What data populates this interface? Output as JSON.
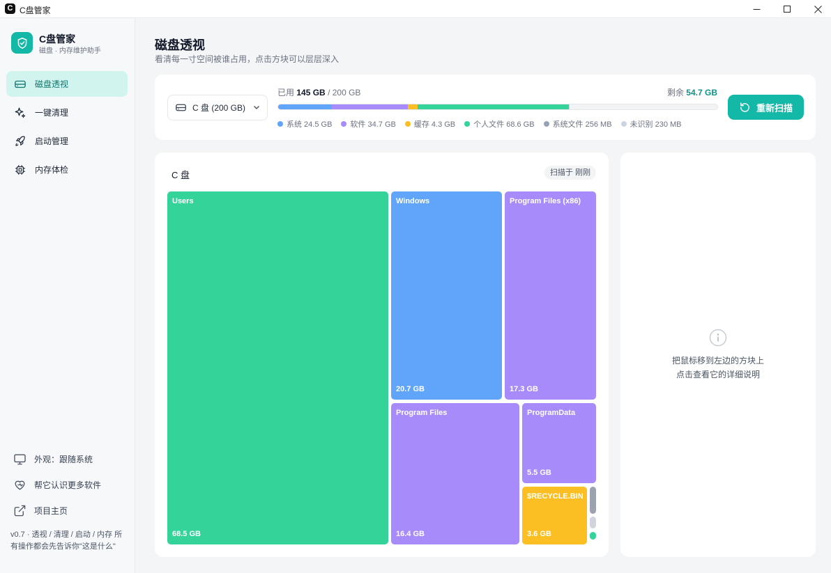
{
  "window": {
    "icon_letter": "C",
    "title": "C盘管家"
  },
  "brand": {
    "name": "C盘管家",
    "subtitle": "磁盘 · 内存维护助手"
  },
  "nav": [
    {
      "label": "磁盘透视",
      "icon": "disk-icon",
      "active": true
    },
    {
      "label": "一键清理",
      "icon": "sparkle-icon",
      "active": false
    },
    {
      "label": "启动管理",
      "icon": "rocket-icon",
      "active": false
    },
    {
      "label": "内存体检",
      "icon": "chip-icon",
      "active": false
    }
  ],
  "footer": {
    "appearance": "外观：跟随系统",
    "help": "帮它认识更多软件",
    "homepage": "项目主页",
    "version": "v0.7 · 透视 / 清理 / 启动 / 内存 所有操作都会先告诉你\"这是什么\""
  },
  "page": {
    "title": "磁盘透视",
    "subtitle": "看清每一寸空间被谁占用，点击方块可以层层深入"
  },
  "drive": {
    "selected": "C 盘 (200 GB)",
    "used_label": "已用",
    "used": "145 GB",
    "total": "/ 200 GB",
    "remain_label": "剩余",
    "remain": "54.7 GB",
    "rescan_label": "重新扫描",
    "segments": [
      {
        "name": "系统",
        "value_gb": 24.5,
        "color": "#60a5fa"
      },
      {
        "name": "软件",
        "value_gb": 34.7,
        "color": "#a78bfa"
      },
      {
        "name": "缓存",
        "value_gb": 4.3,
        "color": "#fbbf24"
      },
      {
        "name": "个人文件",
        "value_gb": 68.6,
        "color": "#34d399"
      },
      {
        "name": "系统文件",
        "value_gb": 0.256,
        "color": "#94a3b8"
      },
      {
        "name": "未识别",
        "value_gb": 0.23,
        "color": "#cbd5e1"
      }
    ],
    "legend": [
      "系统 24.5 GB",
      "软件 34.7 GB",
      "缓存 4.3 GB",
      "个人文件 68.6 GB",
      "系统文件 256 MB",
      "未识别 230 MB"
    ]
  },
  "treemap": {
    "title": "C 盘",
    "scan_status": "扫描于 刚刚",
    "tiles": [
      {
        "name": "Users",
        "size": "68.5 GB",
        "color": "#34d399"
      },
      {
        "name": "Windows",
        "size": "20.7 GB",
        "color": "#60a5fa"
      },
      {
        "name": "Program Files (x86)",
        "size": "17.3 GB",
        "color": "#a78bfa"
      },
      {
        "name": "Program Files",
        "size": "16.4 GB",
        "color": "#a78bfa"
      },
      {
        "name": "ProgramData",
        "size": "5.5 GB",
        "color": "#a78bfa"
      },
      {
        "name": "$RECYCLE.BIN",
        "size": "3.6 GB",
        "color": "#fbbf24"
      }
    ],
    "small_tile_colors": [
      "#9ca3af",
      "#d1d5db",
      "#34d399"
    ]
  },
  "info_panel": {
    "line1": "把鼠标移到左边的方块上",
    "line2": "点击查看它的详细说明"
  }
}
